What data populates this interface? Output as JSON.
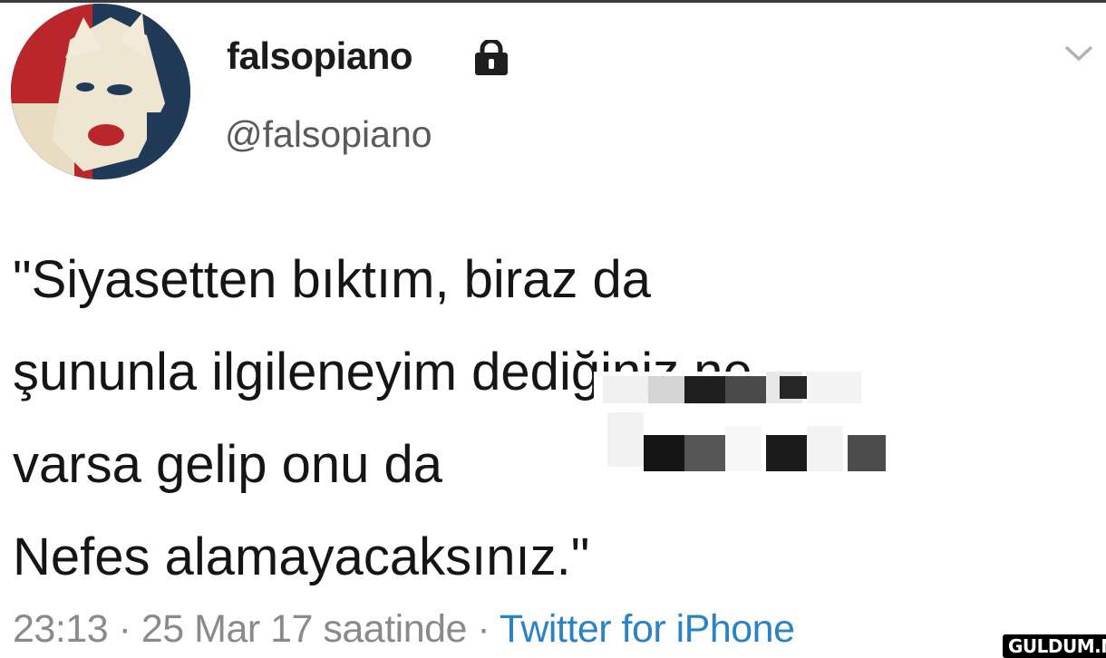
{
  "tweet": {
    "display_name": "falsopiano",
    "handle": "@falsopiano",
    "verified_protected_icon": "lock-icon",
    "menu_icon": "chevron-down-icon",
    "text_lines": [
      "\"Siyasetten bıktım, biraz da",
      "şununla ilgileneyim dediğiniz ne",
      "varsa gelip onu da",
      "Nefes alamayacaksınız.\""
    ],
    "time": "23:13",
    "separator": "·",
    "date": "25 Mar 17 saatinde",
    "source": "Twitter for iPhone"
  },
  "watermark": "GULDUM.NET",
  "colors": {
    "text": "#151515",
    "handle": "#5a5a5a",
    "meta": "#8a8a8a",
    "link": "#2b83c5",
    "background": "#ffffff"
  }
}
